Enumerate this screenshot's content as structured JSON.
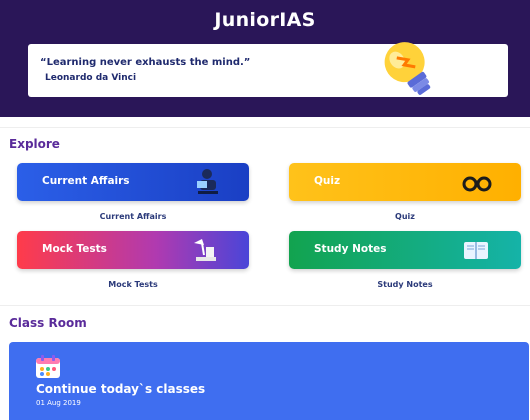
{
  "app": {
    "title": "JuniorIAS"
  },
  "quote": {
    "text": "“Learning never exhausts the mind.”",
    "author": "Leonardo da Vinci",
    "icon": "lightbulb-icon"
  },
  "explore": {
    "title": "Explore",
    "tiles": [
      {
        "label": "Current Affairs",
        "caption": "Current Affairs",
        "icon": "reader-icon"
      },
      {
        "label": "Quiz",
        "caption": "Quiz",
        "icon": "glasses-icon"
      },
      {
        "label": "Mock Tests",
        "caption": "Mock Tests",
        "icon": "desk-lamp-icon"
      },
      {
        "label": "Study Notes",
        "caption": "Study Notes",
        "icon": "open-book-icon"
      }
    ]
  },
  "classroom": {
    "title": "Class Room",
    "card_title": "Continue today`s classes",
    "date": "01 Aug 2019",
    "icon": "calendar-icon"
  },
  "colors": {
    "header": "#2a1658",
    "section_title": "#5a2b9a",
    "class_card": "#3f6ef0"
  }
}
